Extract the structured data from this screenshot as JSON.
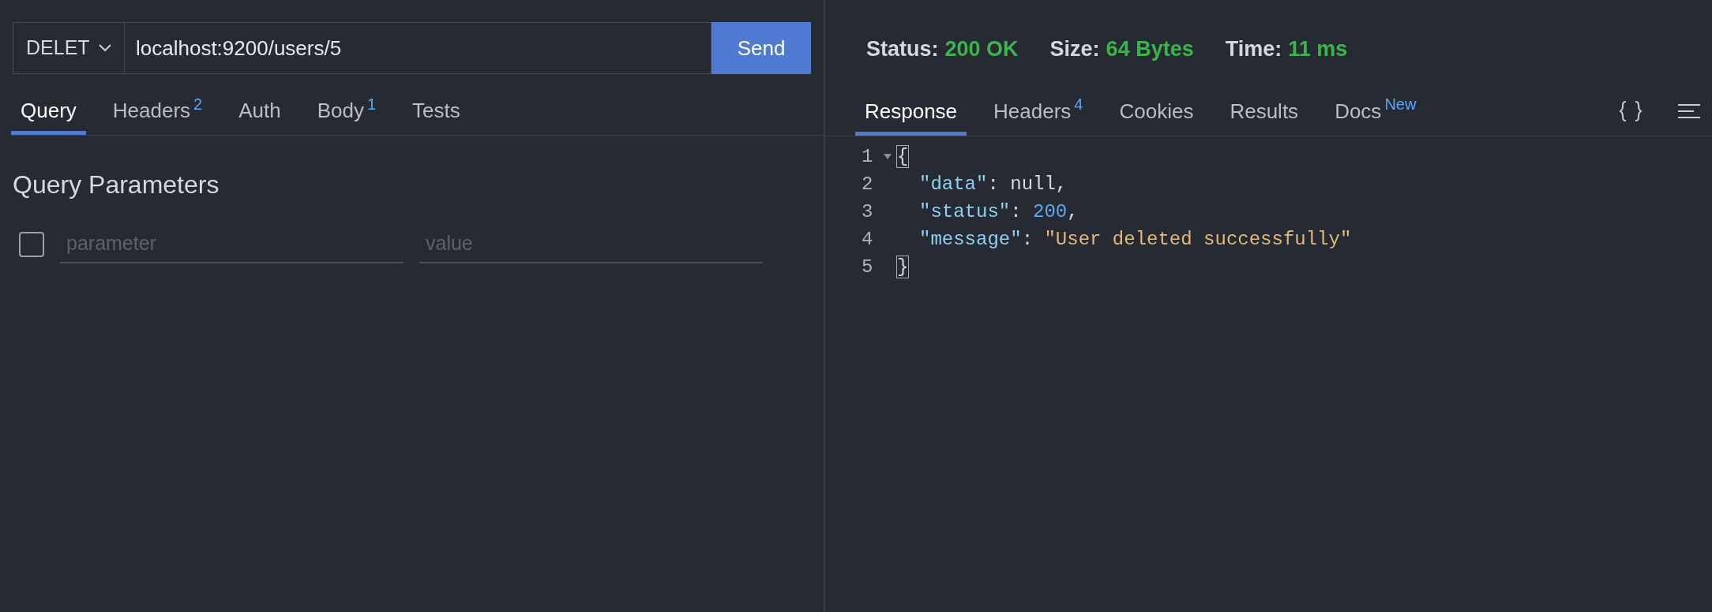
{
  "request": {
    "method": "DELET",
    "url": "localhost:9200/users/5",
    "send_label": "Send"
  },
  "request_tabs": [
    {
      "label": "Query",
      "selected": true
    },
    {
      "label": "Headers",
      "badge": "2",
      "selected": false
    },
    {
      "label": "Auth",
      "selected": false
    },
    {
      "label": "Body",
      "badge": "1",
      "selected": false
    },
    {
      "label": "Tests",
      "selected": false
    }
  ],
  "query": {
    "title": "Query Parameters",
    "rows": [
      {
        "checked": false,
        "parameter_placeholder": "parameter",
        "value_placeholder": "value"
      }
    ]
  },
  "response_stats": [
    {
      "label": "Status:",
      "value": "200 OK"
    },
    {
      "label": "Size:",
      "value": "64 Bytes"
    },
    {
      "label": "Time:",
      "value": "11 ms"
    }
  ],
  "response_tabs": [
    {
      "label": "Response",
      "selected": true
    },
    {
      "label": "Headers",
      "badge": "4",
      "selected": false
    },
    {
      "label": "Cookies",
      "selected": false
    },
    {
      "label": "Results",
      "selected": false
    },
    {
      "label": "Docs",
      "badge": "New",
      "selected": false
    }
  ],
  "code_lines": [
    {
      "number": "1",
      "foldable": true,
      "indented": false,
      "tokens": [
        {
          "kind": "bracket",
          "text": "{"
        }
      ]
    },
    {
      "number": "2",
      "foldable": false,
      "indented": true,
      "tokens": [
        {
          "kind": "key",
          "text": "\"data\""
        },
        {
          "kind": "plain",
          "text": ": null,"
        }
      ]
    },
    {
      "number": "3",
      "foldable": false,
      "indented": true,
      "tokens": [
        {
          "kind": "key",
          "text": "\"status\""
        },
        {
          "kind": "plain",
          "text": ": "
        },
        {
          "kind": "number",
          "text": "200"
        },
        {
          "kind": "plain",
          "text": ","
        }
      ]
    },
    {
      "number": "4",
      "foldable": false,
      "indented": true,
      "tokens": [
        {
          "kind": "key",
          "text": "\"message\""
        },
        {
          "kind": "plain",
          "text": ": "
        },
        {
          "kind": "string",
          "text": "\"User deleted successfully\""
        }
      ]
    },
    {
      "number": "5",
      "foldable": false,
      "indented": false,
      "tokens": [
        {
          "kind": "bracket",
          "text": "}"
        }
      ]
    }
  ]
}
